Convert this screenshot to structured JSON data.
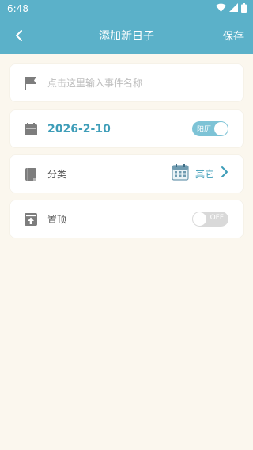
{
  "status_bar": {
    "time": "6:48"
  },
  "header": {
    "title": "添加新日子",
    "save_label": "保存"
  },
  "event_name": {
    "placeholder": "点击这里输入事件名称"
  },
  "date_row": {
    "date": "2026-2-10",
    "calendar_toggle_label": "阳历",
    "calendar_toggle_on": true
  },
  "category_row": {
    "label": "分类",
    "value": "其它"
  },
  "pin_row": {
    "label": "置顶",
    "toggle_label": "OFF",
    "toggle_on": false
  },
  "colors": {
    "accent": "#5BB1C9",
    "text_accent": "#3E9DB8",
    "background": "#FBF7EE"
  }
}
